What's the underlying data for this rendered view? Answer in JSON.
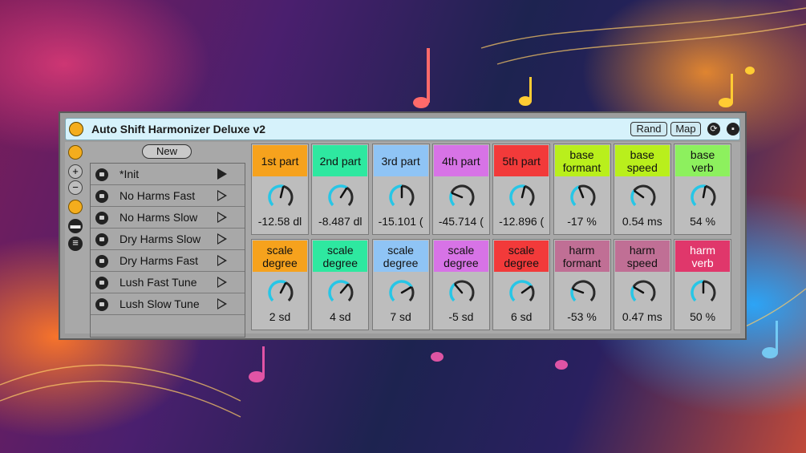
{
  "device": {
    "title": "Auto Shift Harmonizer Deluxe v2",
    "rand_label": "Rand",
    "map_label": "Map",
    "new_label": "New"
  },
  "presets": [
    {
      "name": "*Init",
      "active": true
    },
    {
      "name": "No Harms Fast",
      "active": false
    },
    {
      "name": "No Harms Slow",
      "active": false
    },
    {
      "name": "Dry Harms Slow",
      "active": false
    },
    {
      "name": "Dry Harms Fast",
      "active": false
    },
    {
      "name": "Lush Fast Tune",
      "active": false
    },
    {
      "name": "Lush Slow Tune",
      "active": false
    }
  ],
  "params_row1": [
    {
      "label": "1st part",
      "color": "#f6a21d",
      "value": "-12.58 dl",
      "level": 0.55
    },
    {
      "label": "2nd part",
      "color": "#2ee8a0",
      "value": "-8.487 dl",
      "level": 0.62
    },
    {
      "label": "3rd part",
      "color": "#8fc4f5",
      "value": "-15.101 (",
      "level": 0.5
    },
    {
      "label": "4th part",
      "color": "#d773e6",
      "value": "-45.714 (",
      "level": 0.25
    },
    {
      "label": "5th part",
      "color": "#f23a3a",
      "value": "-12.896 (",
      "level": 0.55
    },
    {
      "label": "base\nformant",
      "color": "#b9ef1c",
      "value": "-17 %",
      "level": 0.42
    },
    {
      "label": "base\nspeed",
      "color": "#b9ef1c",
      "value": "0.54 ms",
      "level": 0.3
    },
    {
      "label": "base\nverb",
      "color": "#8df05e",
      "value": "54 %",
      "level": 0.54
    }
  ],
  "params_row2": [
    {
      "label": "scale\ndegree",
      "color": "#f6a21d",
      "value": "2 sd",
      "level": 0.6
    },
    {
      "label": "scale\ndegree",
      "color": "#2ee8a0",
      "value": "4 sd",
      "level": 0.65
    },
    {
      "label": "scale\ndegree",
      "color": "#8fc4f5",
      "value": "7 sd",
      "level": 0.72
    },
    {
      "label": "scale\ndegree",
      "color": "#d773e6",
      "value": "-5 sd",
      "level": 0.35
    },
    {
      "label": "scale\ndegree",
      "color": "#f23a3a",
      "value": "6 sd",
      "level": 0.7
    },
    {
      "label": "harm\nformant",
      "color": "#c06f95",
      "value": "-53 %",
      "level": 0.24
    },
    {
      "label": "harm\nspeed",
      "color": "#c06f95",
      "value": "0.47 ms",
      "level": 0.28
    },
    {
      "label": "harm\nverb",
      "color": "#e0376b",
      "value": "50 %",
      "level": 0.5,
      "light": true
    }
  ],
  "colors": {
    "knob_arc": "#27c6e6",
    "knob_track": "#2a2a2a"
  }
}
